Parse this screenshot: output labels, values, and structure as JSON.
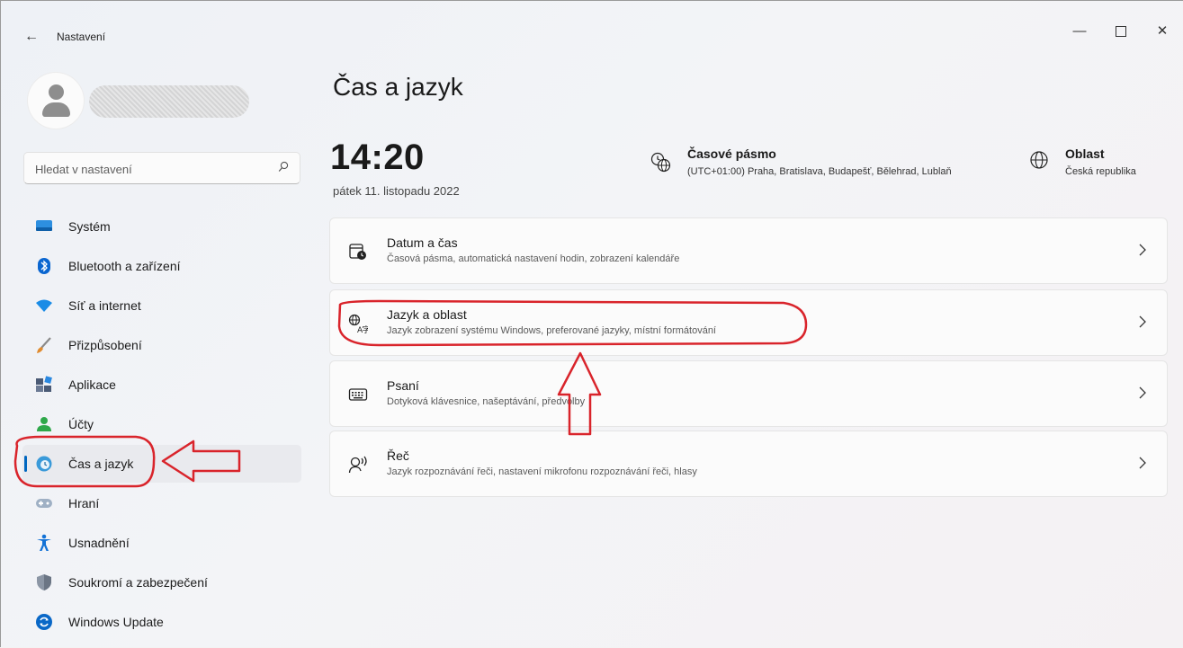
{
  "window": {
    "title": "Nastavení",
    "back_glyph": "←",
    "min_glyph": "—",
    "close_glyph": "✕"
  },
  "sidebar": {
    "search": {
      "placeholder": "Hledat v nastavení",
      "value": ""
    },
    "items": [
      {
        "label": "Systém",
        "icon": "monitor-icon",
        "color": "#0f6cbd"
      },
      {
        "label": "Bluetooth a zařízení",
        "icon": "bluetooth-icon",
        "color": "#0a66d0"
      },
      {
        "label": "Síť a internet",
        "icon": "wifi-icon",
        "color": "#1a8ce6"
      },
      {
        "label": "Přizpůsobení",
        "icon": "brush-icon",
        "color": "#d87a2b"
      },
      {
        "label": "Aplikace",
        "icon": "apps-icon",
        "color": "#4a5a75"
      },
      {
        "label": "Účty",
        "icon": "person-icon",
        "color": "#2ea84a"
      },
      {
        "label": "Čas a jazyk",
        "icon": "globe-clock-icon",
        "color": "#1e88c9",
        "active": true
      },
      {
        "label": "Hraní",
        "icon": "gamepad-icon",
        "color": "#8a9bb0"
      },
      {
        "label": "Usnadnění",
        "icon": "accessibility-icon",
        "color": "#1372d6"
      },
      {
        "label": "Soukromí a zabezpečení",
        "icon": "shield-icon",
        "color": "#7d8796"
      },
      {
        "label": "Windows Update",
        "icon": "update-icon",
        "color": "#0a68c7"
      }
    ]
  },
  "main": {
    "title": "Čas a jazyk",
    "clock": "14:20",
    "date": "pátek 11. listopadu 2022",
    "timezone": {
      "title": "Časové pásmo",
      "value": "(UTC+01:00) Praha, Bratislava, Budapešť, Bělehrad, Lublaň"
    },
    "region": {
      "title": "Oblast",
      "value": "Česká republika"
    },
    "cards": [
      {
        "title": "Datum a čas",
        "desc": "Časová pásma, automatická nastavení hodin, zobrazení kalendáře",
        "icon": "calendar-clock-icon"
      },
      {
        "title": "Jazyk a oblast",
        "desc": "Jazyk zobrazení systému Windows, preferované jazyky, místní formátování",
        "icon": "language-icon"
      },
      {
        "title": "Psaní",
        "desc": "Dotyková klávesnice, našeptávání, předvolby",
        "icon": "keyboard-icon"
      },
      {
        "title": "Řeč",
        "desc": "Jazyk rozpoznávání řeči, nastavení mikrofonu rozpoznávání řeči, hlasy",
        "icon": "speech-icon"
      }
    ]
  },
  "annotations": {
    "color": "#d9242b"
  }
}
